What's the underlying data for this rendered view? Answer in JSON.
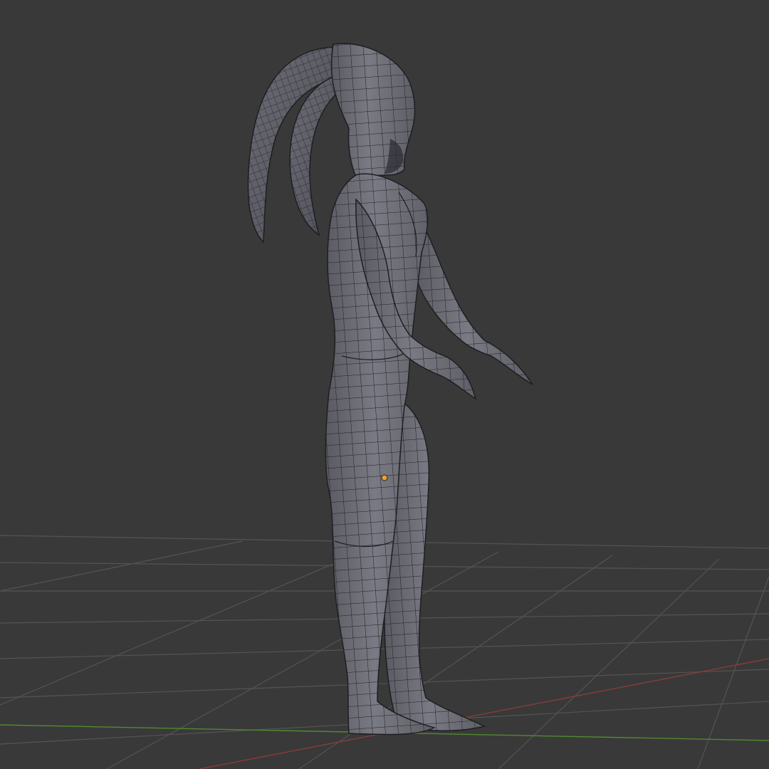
{
  "viewport": {
    "view": "3D Viewport",
    "shading": "solid",
    "overlay": "wireframe",
    "background_color": "#393939"
  },
  "grid": {
    "floor_visible": true,
    "line_color": "#545454",
    "x_axis_color": "#8a3b3b",
    "y_axis_color": "#4f8a2e"
  },
  "object": {
    "type": "mesh",
    "description_icon": "horned-humanoid-mesh",
    "selected": true,
    "surface_color": "#6f6f78",
    "edge_color": "#1e1e22",
    "origin_color": "#f0a030"
  }
}
